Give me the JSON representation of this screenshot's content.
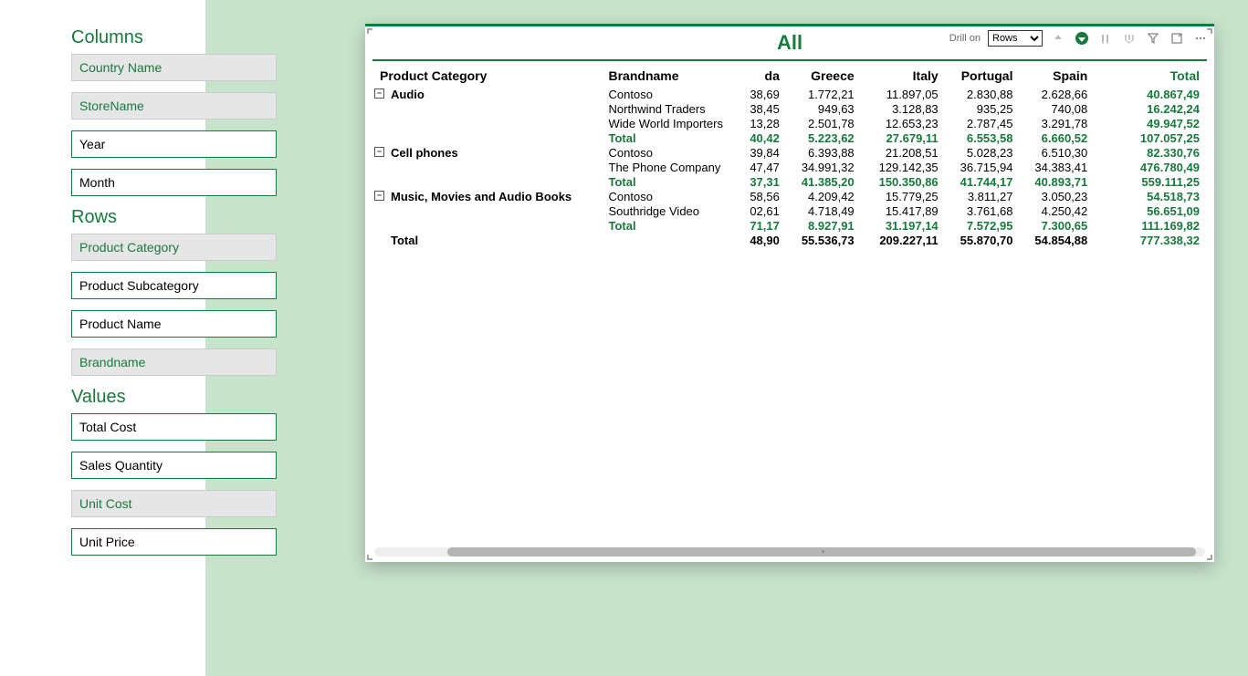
{
  "sidebar": {
    "sections": {
      "columns": {
        "title": "Columns",
        "items": [
          {
            "label": "Country Name",
            "shaded": true
          },
          {
            "label": "StoreName",
            "shaded": true
          },
          {
            "label": "Year",
            "shaded": false
          },
          {
            "label": "Month",
            "shaded": false
          }
        ]
      },
      "rows": {
        "title": "Rows",
        "items": [
          {
            "label": "Product Category",
            "shaded": true
          },
          {
            "label": "Product Subcategory",
            "shaded": false
          },
          {
            "label": "Product Name",
            "shaded": false
          },
          {
            "label": "Brandname",
            "shaded": true
          }
        ]
      },
      "values": {
        "title": "Values",
        "items": [
          {
            "label": "Total Cost",
            "shaded": false
          },
          {
            "label": "Sales Quantity",
            "shaded": false
          },
          {
            "label": "Unit Cost",
            "shaded": true
          },
          {
            "label": "Unit Price",
            "shaded": false
          }
        ]
      }
    }
  },
  "matrix": {
    "title": "All",
    "drill_label": "Drill on",
    "drill_value": "Rows",
    "columns": {
      "row_header1": "Product Category",
      "row_header2": "Brandname",
      "da": "da",
      "greece": "Greece",
      "italy": "Italy",
      "portugal": "Portugal",
      "spain": "Spain",
      "total": "Total"
    },
    "rows": [
      {
        "type": "data",
        "category": "Audio",
        "first": true,
        "brand": "Contoso",
        "da": "38,69",
        "greece": "1.772,21",
        "italy": "11.897,05",
        "portugal": "2.830,88",
        "spain": "2.628,66",
        "total": "40.867,49"
      },
      {
        "type": "data",
        "brand": "Northwind Traders",
        "da": "38,45",
        "greece": "949,63",
        "italy": "3.128,83",
        "portugal": "935,25",
        "spain": "740,08",
        "total": "16.242,24"
      },
      {
        "type": "data",
        "brand": "Wide World Importers",
        "da": "13,28",
        "greece": "2.501,78",
        "italy": "12.653,23",
        "portugal": "2.787,45",
        "spain": "3.291,78",
        "total": "49.947,52"
      },
      {
        "type": "subtotal",
        "brand": "Total",
        "da": "40,42",
        "greece": "5.223,62",
        "italy": "27.679,11",
        "portugal": "6.553,58",
        "spain": "6.660,52",
        "total": "107.057,25"
      },
      {
        "type": "data",
        "category": "Cell phones",
        "first": true,
        "brand": "Contoso",
        "da": "39,84",
        "greece": "6.393,88",
        "italy": "21.208,51",
        "portugal": "5.028,23",
        "spain": "6.510,30",
        "total": "82.330,76"
      },
      {
        "type": "data",
        "brand": "The Phone Company",
        "da": "47,47",
        "greece": "34.991,32",
        "italy": "129.142,35",
        "portugal": "36.715,94",
        "spain": "34.383,41",
        "total": "476.780,49"
      },
      {
        "type": "subtotal",
        "brand": "Total",
        "da": "37,31",
        "greece": "41.385,20",
        "italy": "150.350,86",
        "portugal": "41.744,17",
        "spain": "40.893,71",
        "total": "559.111,25"
      },
      {
        "type": "data",
        "category": "Music, Movies and Audio Books",
        "first": true,
        "brand": "Contoso",
        "da": "58,56",
        "greece": "4.209,42",
        "italy": "15.779,25",
        "portugal": "3.811,27",
        "spain": "3.050,23",
        "total": "54.518,73"
      },
      {
        "type": "data",
        "brand": "Southridge Video",
        "da": "02,61",
        "greece": "4.718,49",
        "italy": "15.417,89",
        "portugal": "3.761,68",
        "spain": "4.250,42",
        "total": "56.651,09"
      },
      {
        "type": "subtotal",
        "brand": "Total",
        "da": "71,17",
        "greece": "8.927,91",
        "italy": "31.197,14",
        "portugal": "7.572,95",
        "spain": "7.300,65",
        "total": "111.169,82"
      },
      {
        "type": "grandtotal",
        "category": "Total",
        "brand": "",
        "da": "48,90",
        "greece": "55.536,73",
        "italy": "209.227,11",
        "portugal": "55.870,70",
        "spain": "54.854,88",
        "total": "777.338,32"
      }
    ]
  }
}
